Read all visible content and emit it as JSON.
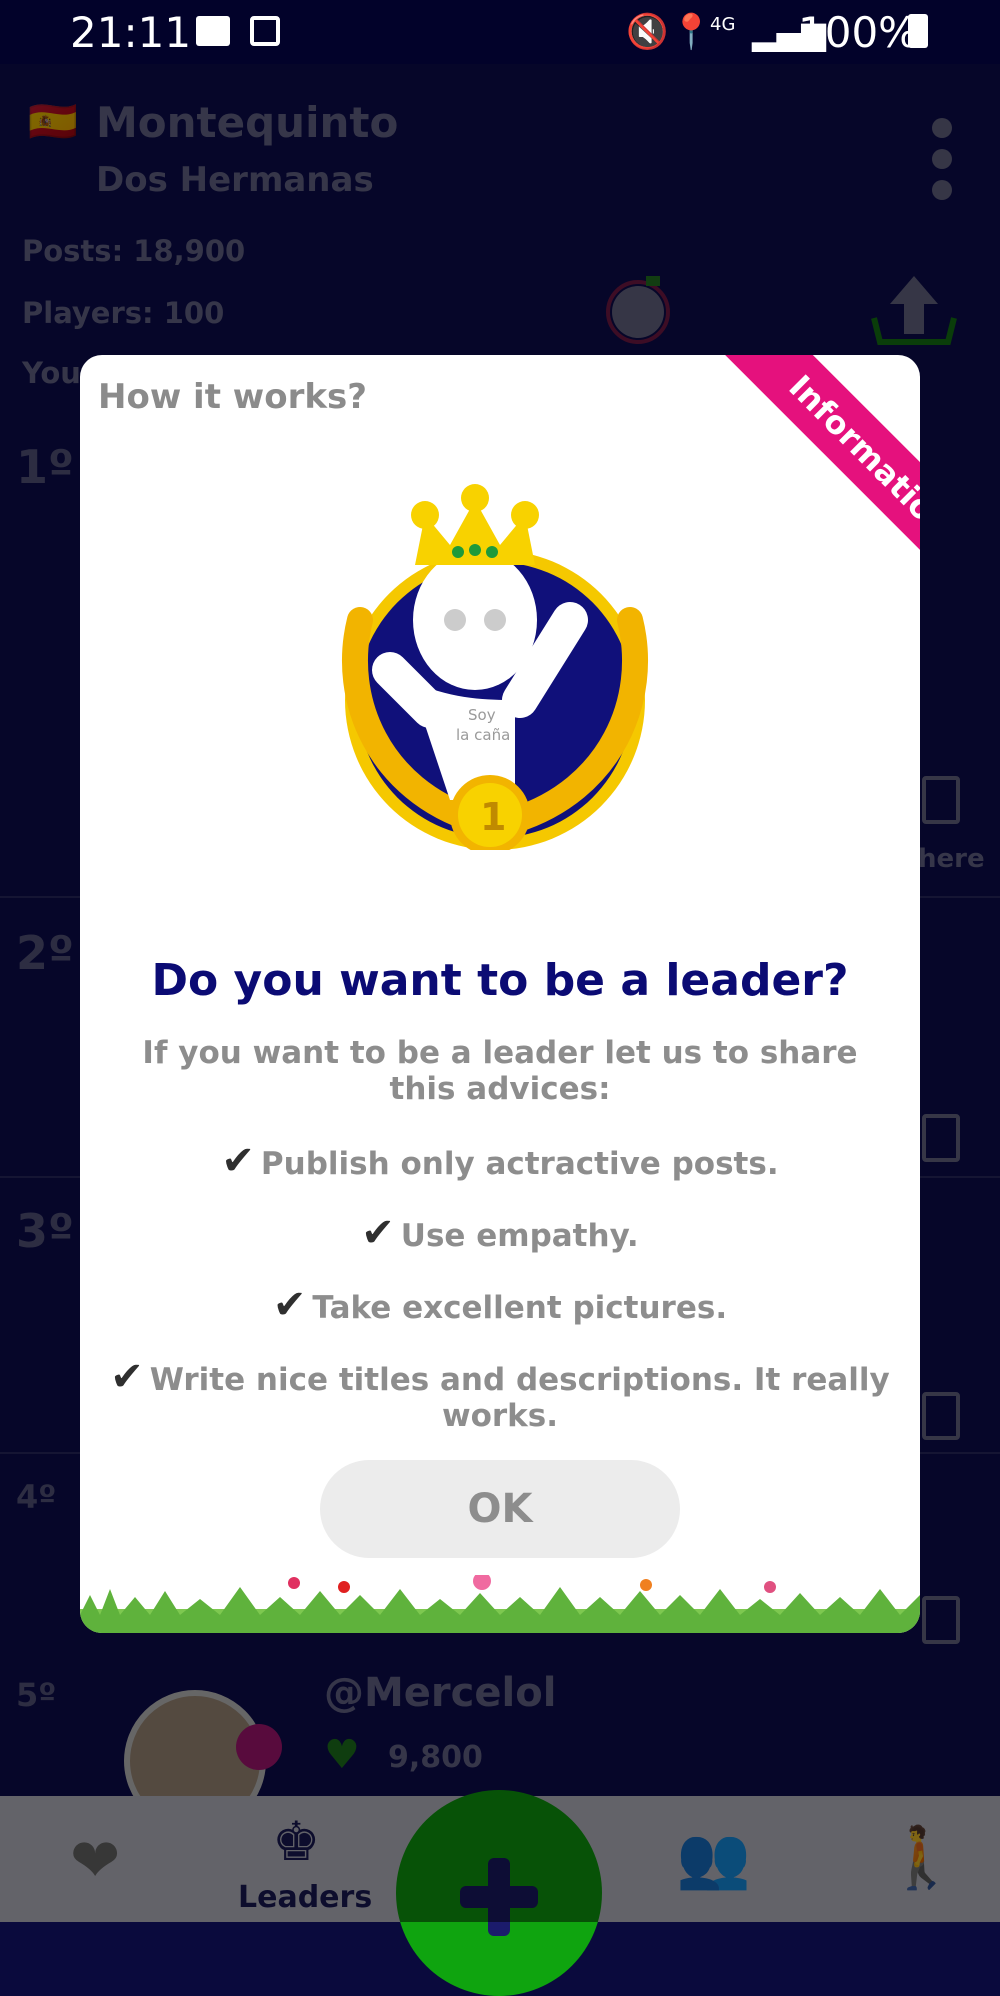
{
  "status_bar": {
    "time": "21:11",
    "network": "4G",
    "battery": "100%"
  },
  "header": {
    "country_flag": "🇪🇸",
    "title": "Montequinto",
    "subtitle": "Dos Hermanas"
  },
  "stats": {
    "posts_label": "Posts:",
    "posts_value": "18,900",
    "players_label": "Players:",
    "players_value": "100",
    "you_label": "You"
  },
  "ranks": [
    "1º",
    "2º",
    "3º",
    "4º",
    "5º"
  ],
  "leader_5": {
    "username": "@Mercelol",
    "likes": "9,800"
  },
  "partial_text": "here",
  "bottom_nav": {
    "leaders_label": "Leaders"
  },
  "modal": {
    "header": "How it works?",
    "ribbon": "Information",
    "badge_text_1": "Soy",
    "badge_text_2": "la caña",
    "medal_number": "1",
    "title": "Do you want to be a leader?",
    "intro": "If you want to be a leader let us to share this advices:",
    "tips": [
      "Publish only actractive posts.",
      "Use empathy.",
      "Take excellent pictures.",
      "Write nice titles and descriptions. It really works."
    ],
    "ok_label": "OK"
  },
  "colors": {
    "ribbon": "#e5117d",
    "title": "#0b0b74",
    "fab": "#0fa40f",
    "background": "#0d0d52"
  }
}
